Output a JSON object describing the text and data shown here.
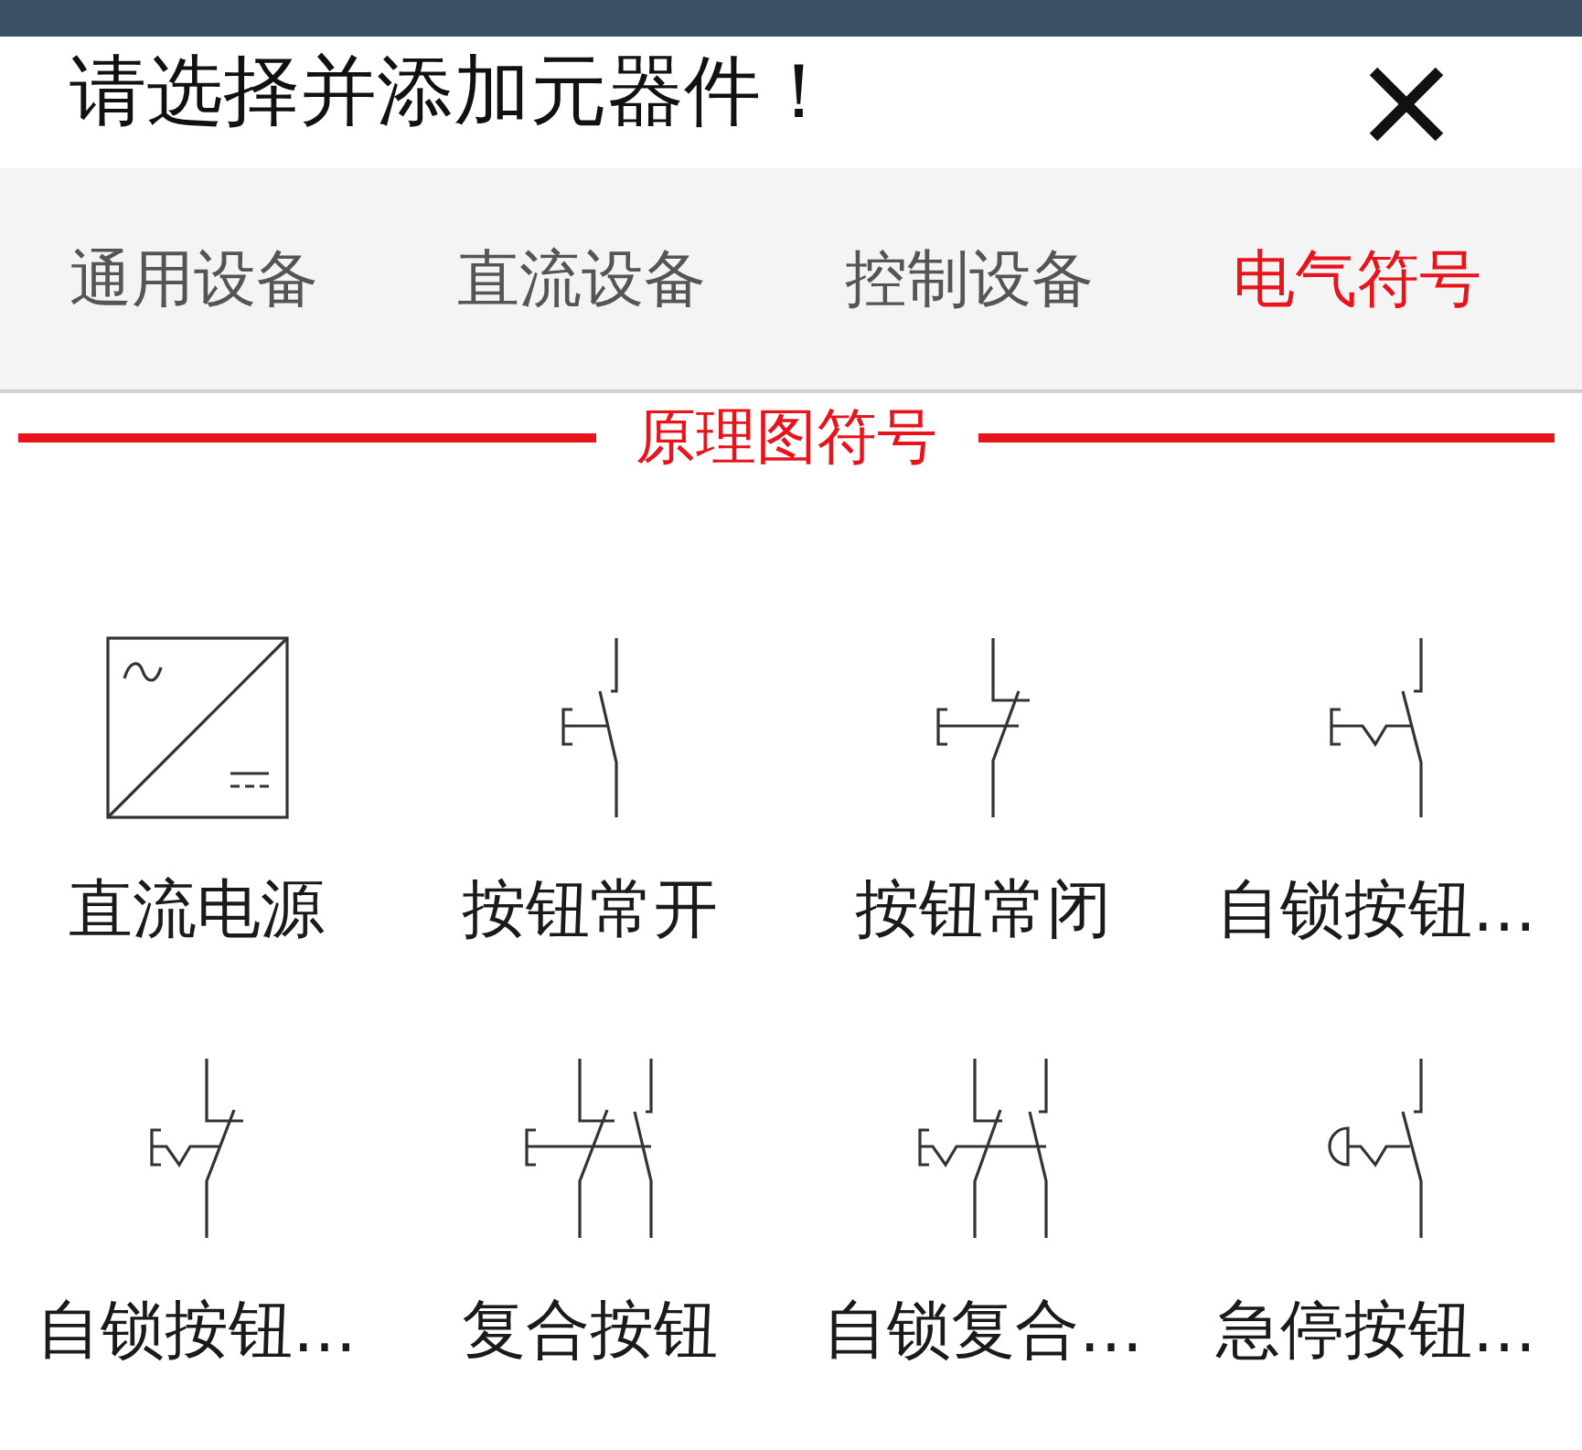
{
  "header": {
    "title": "请选择并添加元器件！"
  },
  "tabs": [
    {
      "label": "通用设备",
      "selected": false
    },
    {
      "label": "直流设备",
      "selected": false
    },
    {
      "label": "控制设备",
      "selected": false
    },
    {
      "label": "电气符号",
      "selected": true
    }
  ],
  "section": {
    "title": "原理图符号"
  },
  "components": [
    {
      "label": "直流电源",
      "kind": "dc-source"
    },
    {
      "label": "按钮常开",
      "kind": "no-button"
    },
    {
      "label": "按钮常闭",
      "kind": "nc-button"
    },
    {
      "label": "自锁按钮…",
      "kind": "latching-no"
    },
    {
      "label": "自锁按钮…",
      "kind": "latching-nc"
    },
    {
      "label": "复合按钮",
      "kind": "compound-button"
    },
    {
      "label": "自锁复合…",
      "kind": "latching-compound"
    },
    {
      "label": "急停按钮…",
      "kind": "emergency-stop"
    }
  ]
}
